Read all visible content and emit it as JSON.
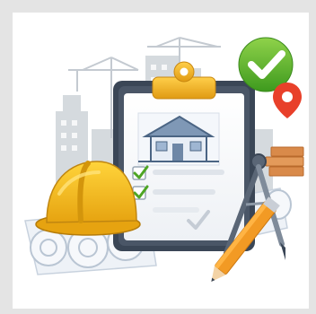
{
  "illustration": {
    "subject": "construction-project-checklist-illustration",
    "palette": {
      "background": "#ffffff",
      "frame": "#e4e4e4",
      "clipboard_board": "#3a4656",
      "clip_gold": "#f2b21e",
      "helmet_yellow": "#f6c01b",
      "check_green": "#5fb32e",
      "pin_red": "#e8402a",
      "brick_orange": "#d98a4a",
      "pencil_orange": "#f29a24",
      "skyline_gray": "#c9cfd6",
      "blueprint_white": "#f3f6fa"
    },
    "icons": [
      "clipboard-icon",
      "house-icon",
      "check-icon",
      "hard-hat-icon",
      "blueprint-roll-icon",
      "compass-icon",
      "pencil-icon",
      "location-pin-icon",
      "brick-stack-icon",
      "crane-icon"
    ]
  }
}
